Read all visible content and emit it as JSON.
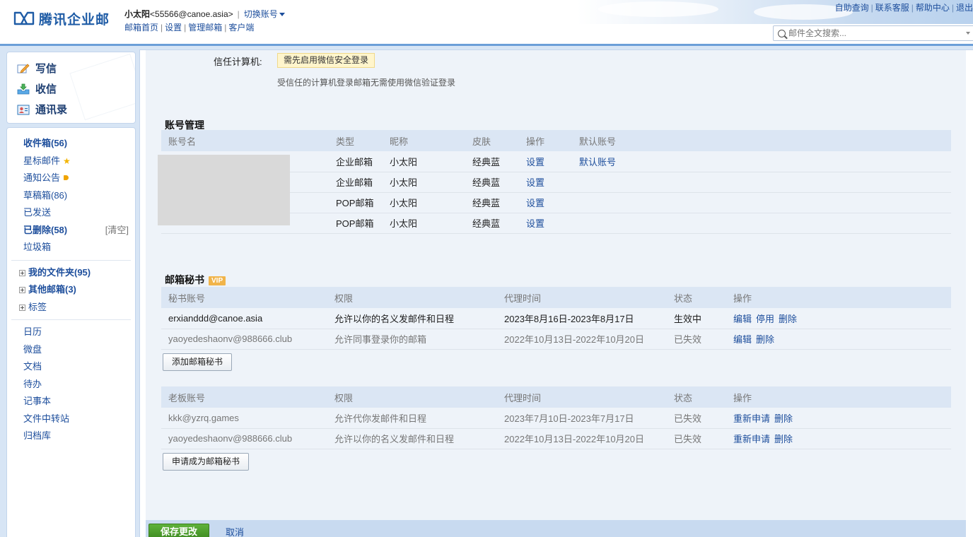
{
  "header": {
    "logo_text": "腾讯企业邮",
    "user_name": "小太阳",
    "user_email": "<55566@canoe.asia>",
    "switch_account": "切换账号",
    "nav": [
      "邮箱首页",
      "设置",
      "管理邮箱",
      "客户端"
    ],
    "top_links": [
      "自助查询",
      "联系客服",
      "帮助中心",
      "退出"
    ],
    "search_placeholder": "邮件全文搜索..."
  },
  "quick_actions": [
    {
      "label": "写信",
      "icon": "compose-icon"
    },
    {
      "label": "收信",
      "icon": "inbox-download-icon"
    },
    {
      "label": "通讯录",
      "icon": "contacts-icon"
    }
  ],
  "folders": {
    "inbox": "收件箱(56)",
    "starred": "星标邮件",
    "notices": "通知公告",
    "drafts": "草稿箱(86)",
    "sent": "已发送",
    "deleted": "已删除(58)",
    "clear": "[清空]",
    "spam": "垃圾箱",
    "my_folders": "我的文件夹(95)",
    "other_mailboxes": "其他邮箱(3)",
    "tags": "标签",
    "apps": [
      "日历",
      "微盘",
      "文档",
      "待办",
      "记事本",
      "文件中转站",
      "归档库"
    ]
  },
  "trust": {
    "label": "信任计算机:",
    "badge": "需先启用微信安全登录",
    "desc": "受信任的计算机登录邮箱无需使用微信验证登录"
  },
  "accounts": {
    "title": "账号管理",
    "headers": [
      "账号名",
      "类型",
      "昵称",
      "皮肤",
      "操作",
      "默认账号"
    ],
    "rows": [
      {
        "type": "企业邮箱",
        "nick": "小太阳",
        "skin": "经典蓝",
        "action": "设置",
        "default": "默认账号"
      },
      {
        "type": "企业邮箱",
        "nick": "小太阳",
        "skin": "经典蓝",
        "action": "设置",
        "default": ""
      },
      {
        "type": "POP邮箱",
        "nick": "小太阳",
        "skin": "经典蓝",
        "action": "设置",
        "default": ""
      },
      {
        "type": "POP邮箱",
        "nick": "小太阳",
        "skin": "经典蓝",
        "action": "设置",
        "default": ""
      }
    ]
  },
  "secretary": {
    "title": "邮箱秘书",
    "vip": "VIP",
    "headers": [
      "秘书账号",
      "权限",
      "代理时间",
      "状态",
      "操作"
    ],
    "rows": [
      {
        "account": "erxianddd@canoe.asia",
        "perm": "允许以你的名义发邮件和日程",
        "period": "2023年8月16日-2023年8月17日",
        "status": "生效中",
        "actions": [
          "编辑",
          "停用",
          "删除"
        ],
        "active": true
      },
      {
        "account": "yaoyedeshaonv@988666.club",
        "perm": "允许同事登录你的邮箱",
        "period": "2022年10月13日-2022年10月20日",
        "status": "已失效",
        "actions": [
          "编辑",
          "删除"
        ],
        "active": false
      }
    ],
    "add_button": "添加邮箱秘书"
  },
  "boss": {
    "headers": [
      "老板账号",
      "权限",
      "代理时间",
      "状态",
      "操作"
    ],
    "rows": [
      {
        "account": "kkk@yzrq.games",
        "perm": "允许代你发邮件和日程",
        "period": "2023年7月10日-2023年7月17日",
        "status": "已失效",
        "actions": [
          "重新申请",
          "删除"
        ]
      },
      {
        "account": "yaoyedeshaonv@988666.club",
        "perm": "允许以你的名义发邮件和日程",
        "period": "2022年10月13日-2022年10月20日",
        "status": "已失效",
        "actions": [
          "重新申请",
          "删除"
        ]
      }
    ],
    "apply_button": "申请成为邮箱秘书"
  },
  "footer": {
    "save": "保存更改",
    "cancel": "取消"
  },
  "colors": {
    "link": "#1d4e9c",
    "frame": "#d7e5f5",
    "header_row": "#dbe6f4",
    "save_green": "#4a9e2a",
    "vip": "#f1b44a"
  }
}
